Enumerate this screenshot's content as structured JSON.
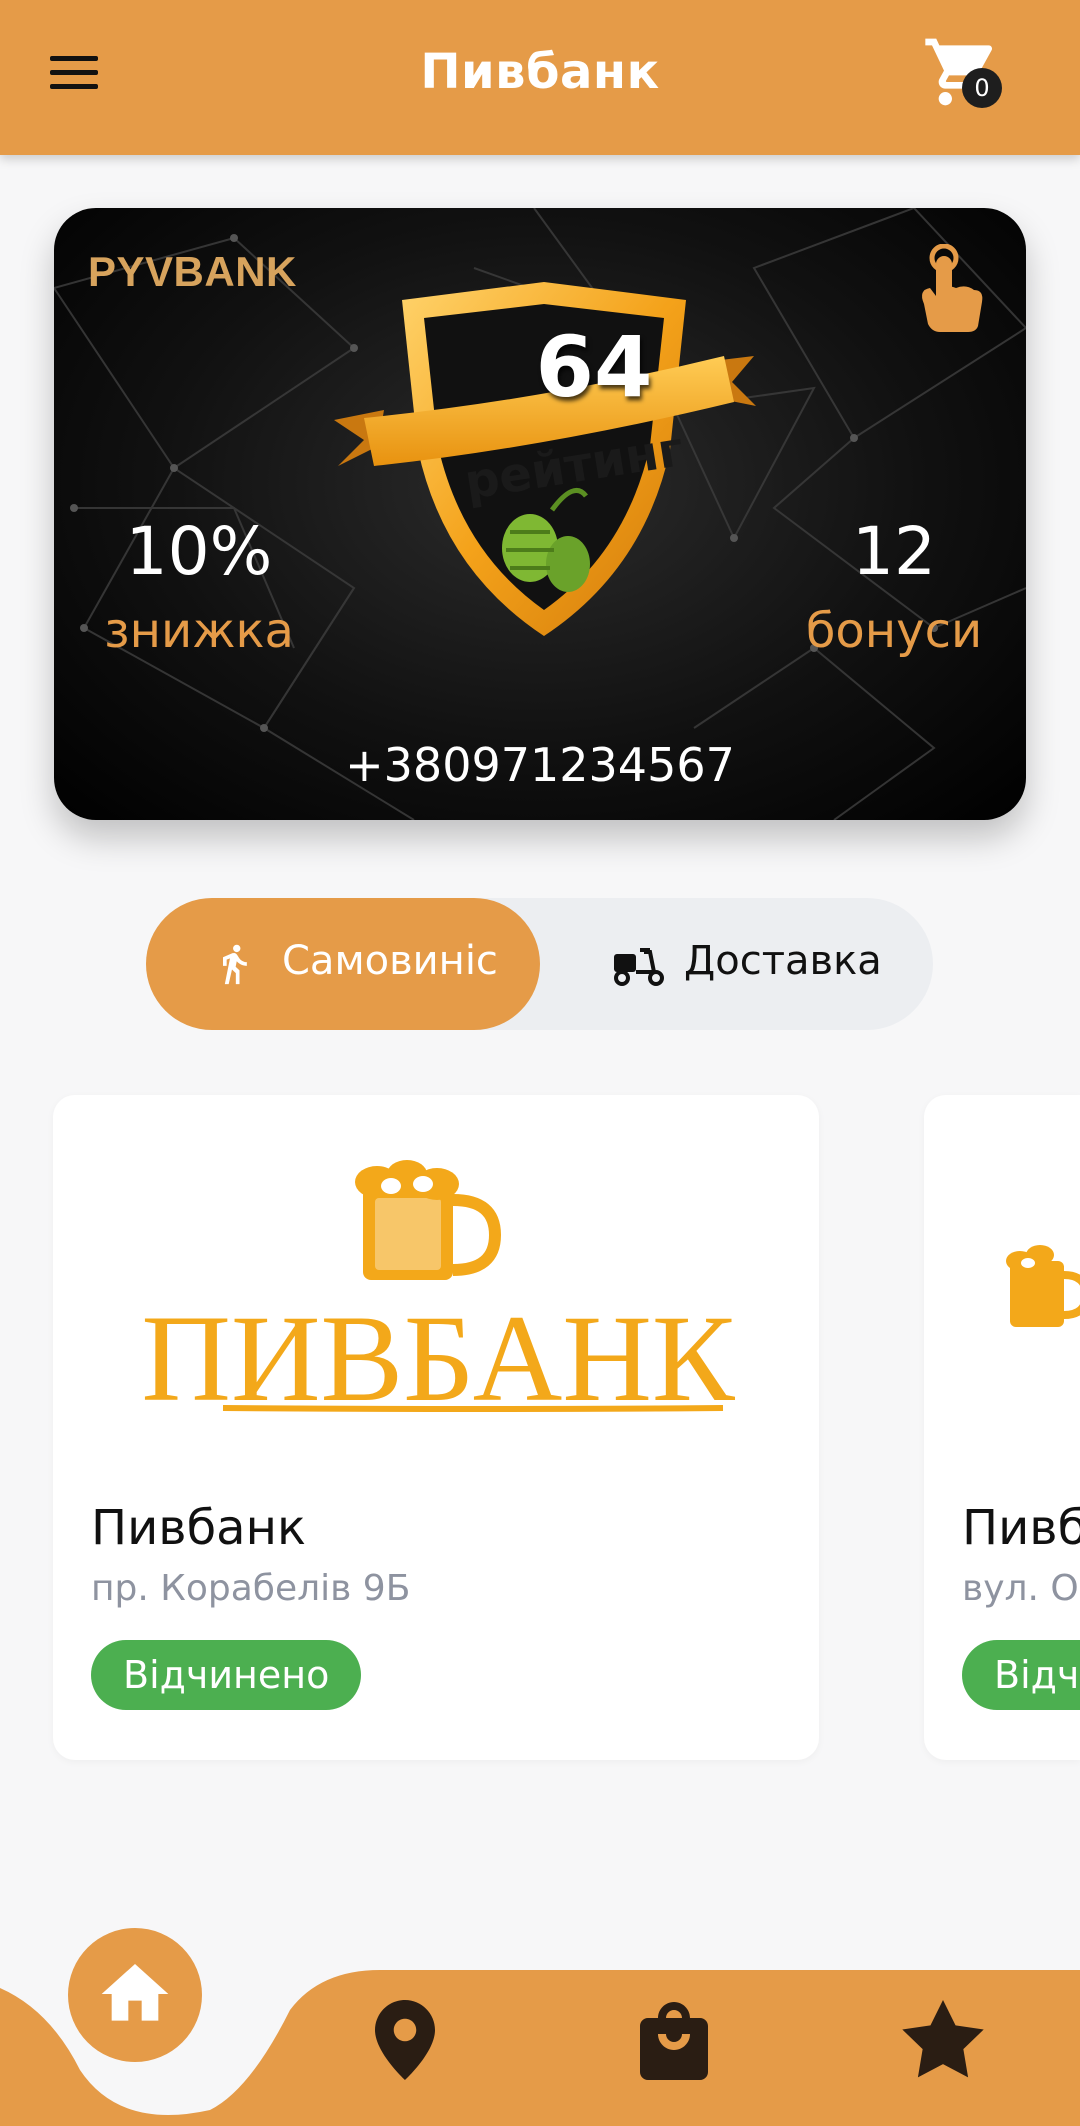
{
  "header": {
    "title": "Пивбанк",
    "cart_count": "0",
    "menu_icon": "menu-icon",
    "cart_icon": "cart-icon"
  },
  "loyalty_card": {
    "brand": "PYVBANK",
    "rating_value": "64",
    "rating_label": "рейтинг",
    "discount_value": "10%",
    "discount_label": "знижка",
    "bonus_value": "12",
    "bonus_label": "бонуси",
    "phone": "+380971234567",
    "tap_icon": "tap-hand-icon"
  },
  "delivery_toggle": {
    "pickup_label": "Самовиніс",
    "delivery_label": "Доставка",
    "selected": "pickup"
  },
  "shops": [
    {
      "name": "Пивбанк",
      "address": "пр. Корабелів 9Б",
      "status": "Відчинено",
      "logo_text": "ПИВБАНК"
    },
    {
      "name": "Пивбанк",
      "address": "вул. Ol",
      "status": "Відчинено"
    }
  ],
  "bottom_nav": {
    "active": "home",
    "items": [
      "home-icon",
      "map-pin-icon",
      "shopping-bag-icon",
      "star-icon"
    ]
  },
  "colors": {
    "accent": "#e59b48",
    "open_status": "#4caf50",
    "card_bg": "#111111"
  }
}
